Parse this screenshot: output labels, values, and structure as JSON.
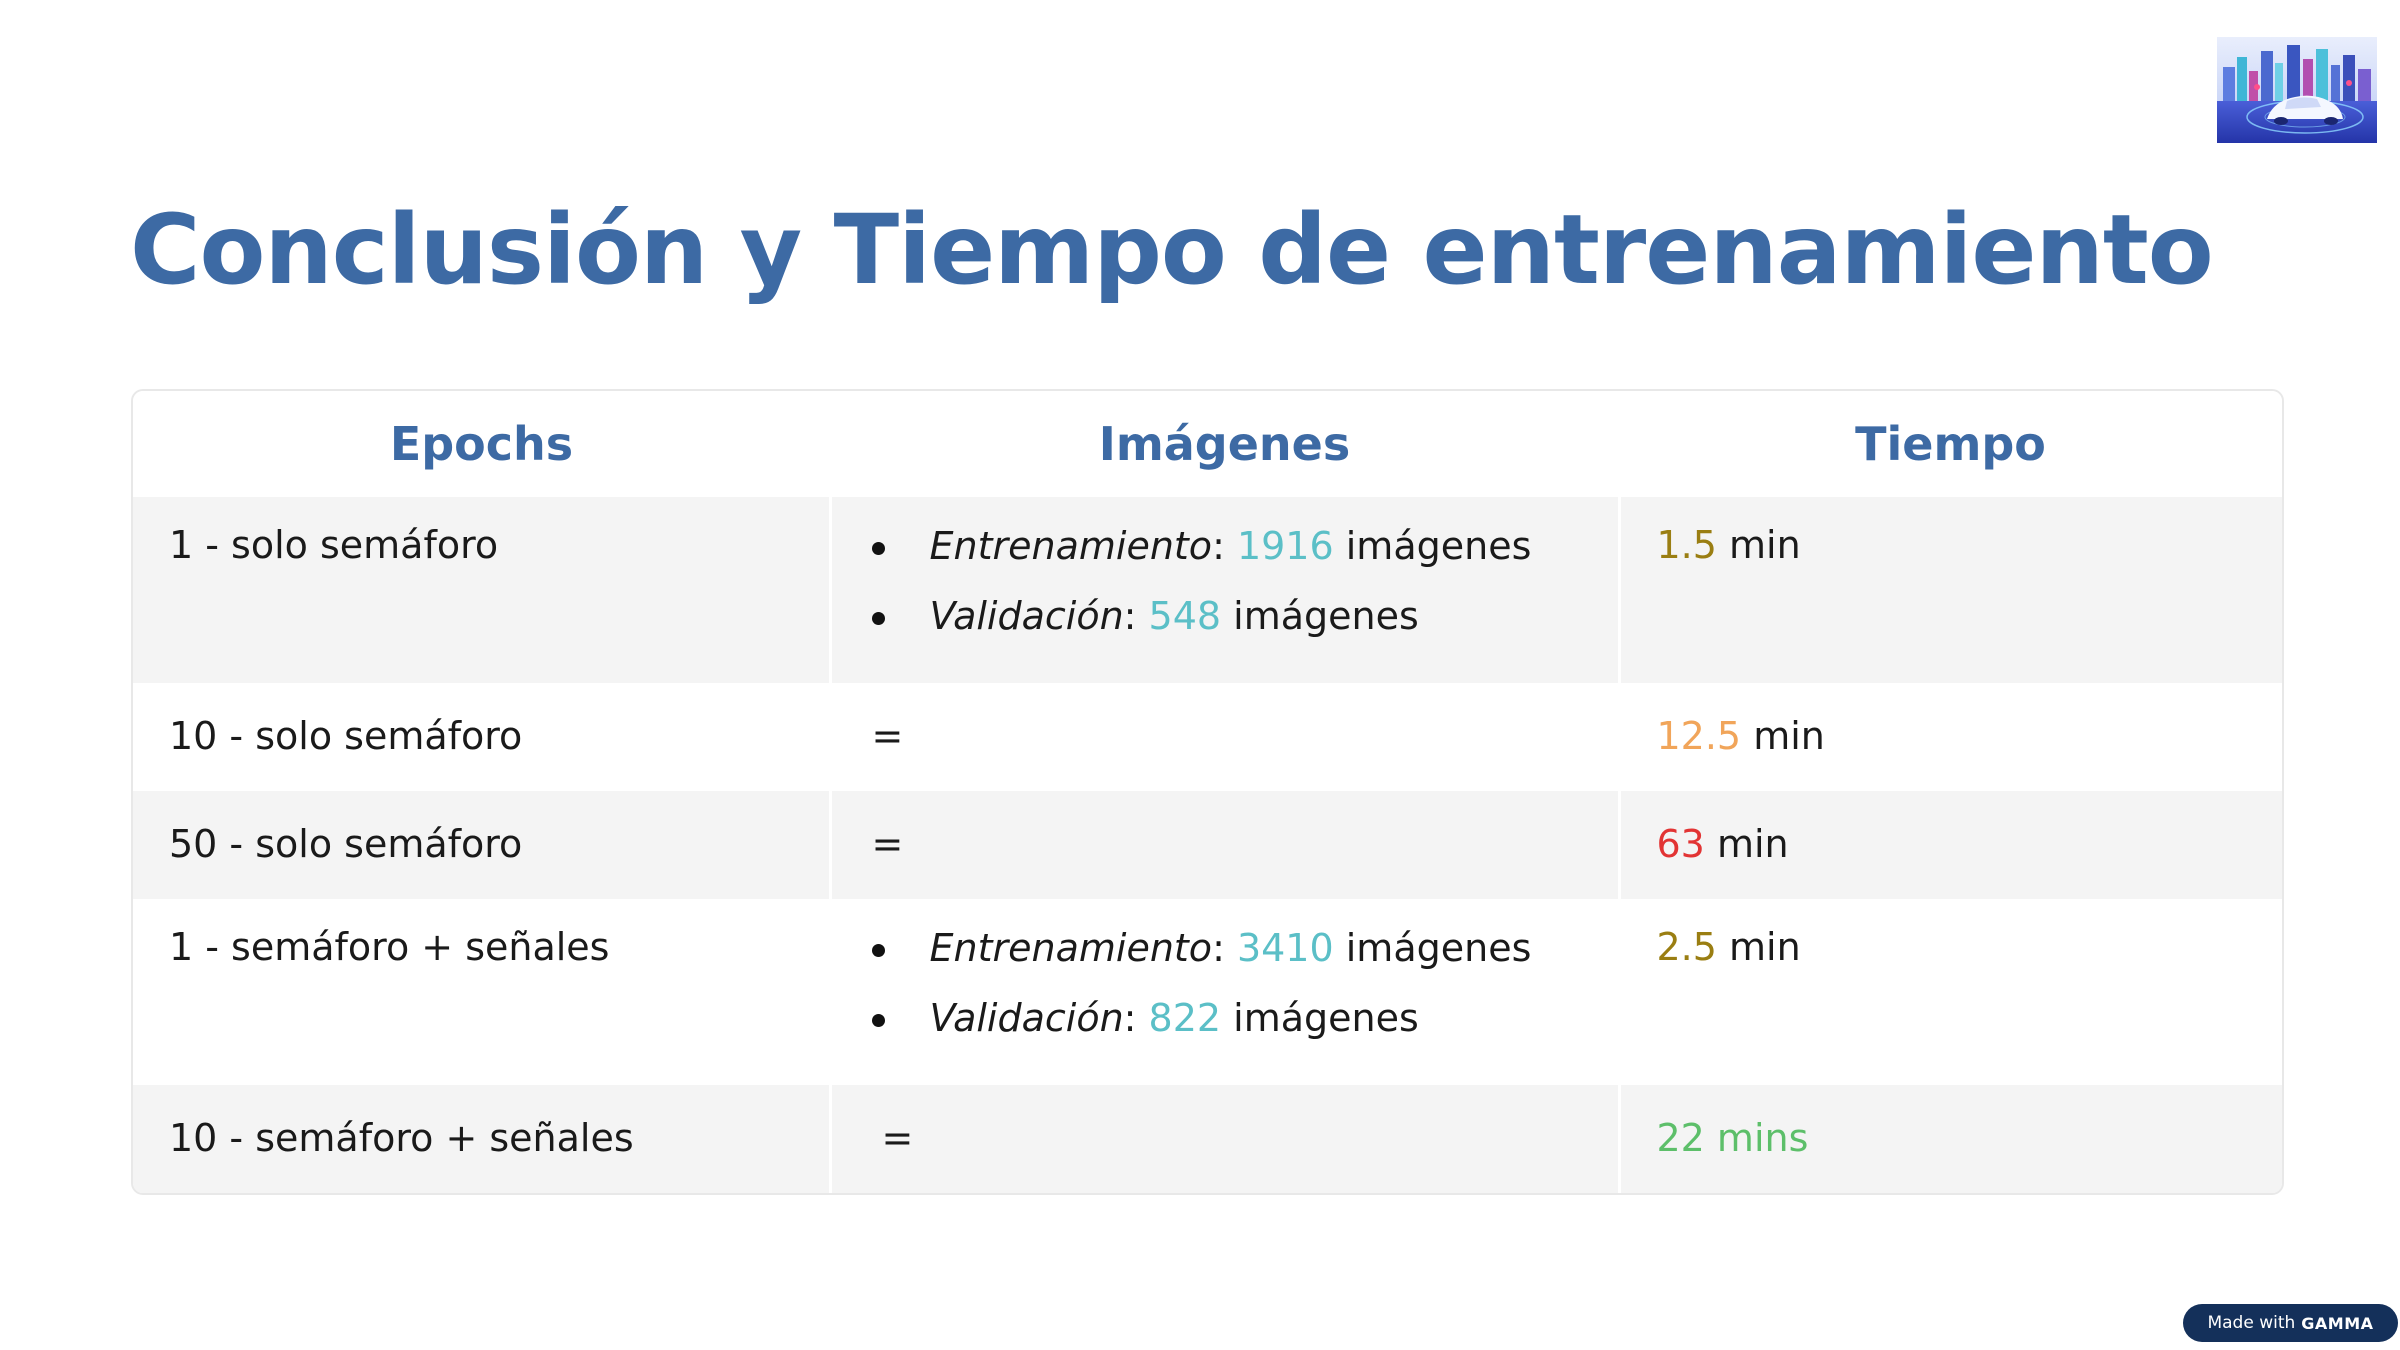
{
  "slide": {
    "title": "Conclusión y Tiempo de entrenamiento"
  },
  "table": {
    "headers": [
      "Epochs",
      "Imágenes",
      "Tiempo"
    ],
    "rows": [
      {
        "epochs": "1 - solo semáforo",
        "images": [
          {
            "label": "Entrenamiento",
            "sep": ": ",
            "count": "1916",
            "unit": " imágenes"
          },
          {
            "label": "Validación",
            "sep": ": ",
            "count": "548",
            "unit": " imágenes"
          }
        ],
        "time_value": "1.5",
        "time_unit": " min",
        "time_color": "#9a7e12"
      },
      {
        "epochs": "10 - solo semáforo",
        "images_same": "=",
        "time_value": "12.5",
        "time_unit": " min",
        "time_color": "#f1a55a"
      },
      {
        "epochs": "50 - solo semáforo",
        "images_same": "=",
        "time_value": "63",
        "time_unit": " min",
        "time_color": "#e23434"
      },
      {
        "epochs": "1 - semáforo + señales",
        "images": [
          {
            "label": "Entrenamiento",
            "sep": ": ",
            "count": "3410",
            "unit": " imágenes"
          },
          {
            "label": "Validación",
            "sep": ": ",
            "count": "822",
            "unit": " imágenes"
          }
        ],
        "time_value": "2.5",
        "time_unit": " min",
        "time_color": "#9a7e12"
      },
      {
        "epochs": "10 - semáforo + señales",
        "images_same": "=",
        "time_value": "22 mins",
        "time_unit": "",
        "time_color": "#5dbf6a"
      }
    ]
  },
  "badge": {
    "prefix": "Made with",
    "brand": "GAMMA"
  },
  "colors": {
    "title": "#3d6aa4",
    "count_teal": "#5bbfc7",
    "row_gray": "#f4f4f4",
    "badge_bg": "#14305a"
  },
  "icons": {
    "thumbnail": "self-driving-car-city-illustration"
  }
}
